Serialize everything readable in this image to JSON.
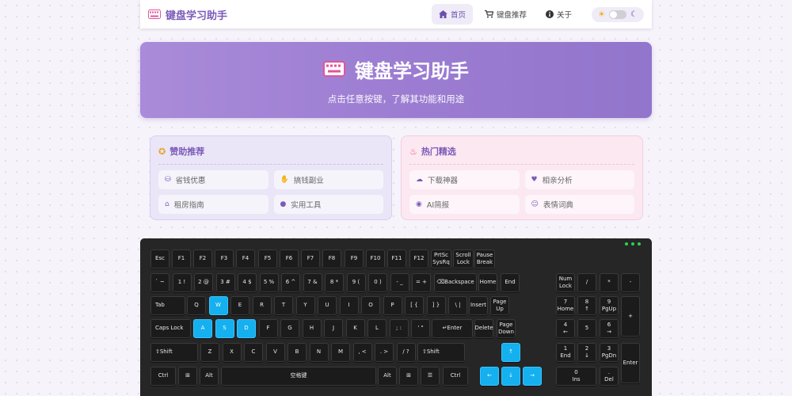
{
  "navbar": {
    "brand": "键盘学习助手",
    "links": [
      {
        "label": "首页",
        "icon": "home-icon",
        "active": true
      },
      {
        "label": "键盘推荐",
        "icon": "cart-icon",
        "active": false
      },
      {
        "label": "关于",
        "icon": "info-icon",
        "active": false
      }
    ],
    "theme_toggle": {
      "light_icon": "sun-icon",
      "dark_icon": "moon-icon",
      "state": "light"
    }
  },
  "hero": {
    "title": "键盘学习助手",
    "subtitle": "点击任意按键，了解其功能和用途"
  },
  "sponsor": {
    "title": "赞助推荐",
    "items": [
      {
        "label": "省钱优惠",
        "icon": "coins-icon"
      },
      {
        "label": "搞钱副业",
        "icon": "hand-coin-icon"
      },
      {
        "label": "租房指南",
        "icon": "house-icon"
      },
      {
        "label": "实用工具",
        "icon": "bulb-icon"
      }
    ]
  },
  "hot": {
    "title": "热门精选",
    "items": [
      {
        "label": "下载神器",
        "icon": "cloud-download-icon"
      },
      {
        "label": "相亲分析",
        "icon": "heart-icon"
      },
      {
        "label": "AI简报",
        "icon": "robot-icon"
      },
      {
        "label": "表情词典",
        "icon": "smile-icon"
      }
    ]
  },
  "colors": {
    "accent": "#7b5bb8",
    "key_highlight": "#14b0f0",
    "keyboard_bg": "#262626",
    "led": "#2ad34f"
  },
  "keyboard": {
    "highlighted_keys": [
      "W",
      "A",
      "S",
      "D",
      "↑",
      "←",
      "↓",
      "→"
    ],
    "keys": {
      "esc": "Esc",
      "f1": "F1",
      "f2": "F2",
      "f3": "F3",
      "f4": "F4",
      "f5": "F5",
      "f6": "F6",
      "f7": "F7",
      "f8": "F8",
      "f9": "F9",
      "f10": "F10",
      "f11": "F11",
      "f12": "F12",
      "prtsc": "PrtSc\nSysRq",
      "scroll": "Scroll\nLock",
      "pause": "Pause\nBreak",
      "backtick": "` ~",
      "n1": "1 !",
      "n2": "2 @",
      "n3": "3 #",
      "n4": "4 $",
      "n5": "5 %",
      "n6": "6 ^",
      "n7": "7 &",
      "n8": "8 *",
      "n9": "9 (",
      "n0": "0 )",
      "minus": "- _",
      "equal": "= +",
      "backspace": "⌫Backspace",
      "home": "Home",
      "end": "End",
      "tab": "Tab",
      "q": "Q",
      "w": "W",
      "e": "E",
      "r": "R",
      "t": "T",
      "y": "Y",
      "u": "U",
      "i": "I",
      "o": "O",
      "p": "P",
      "lbracket": "[ {",
      "rbracket": "] }",
      "backslash": "\\ |",
      "insert": "Insert",
      "pgup": "Page\nUp",
      "caps": "Caps Lock",
      "a": "A",
      "s": "S",
      "d": "D",
      "f": "F",
      "g": "G",
      "h": "H",
      "j": "J",
      "k": "K",
      "l": "L",
      "semicolon": "; :",
      "quote": "' \"",
      "enter": "↵Enter",
      "delete": "Delete",
      "pgdn": "Page\nDown",
      "lshift": "⇧Shift",
      "z": "Z",
      "x": "X",
      "c": "C",
      "v": "V",
      "b": "B",
      "n": "N",
      "m": "M",
      "comma": ", <",
      "period": ". >",
      "slash": "/ ?",
      "rshift": "⇧Shift",
      "lctrl": "Ctrl",
      "lwin": "⊞",
      "lalt": "Alt",
      "space": "空格键",
      "ralt": "Alt",
      "rwin": "⊞",
      "menu": "☰",
      "rctrl": "Ctrl",
      "up": "↑",
      "left": "←",
      "down": "↓",
      "right": "→",
      "numlock": "Num\nLock",
      "numdiv": "/",
      "nummul": "*",
      "numsub": "-",
      "num7": "7\nHome",
      "num8": "8\n↑",
      "num9": "9\nPgUp",
      "numadd": "+",
      "num4": "4\n←",
      "num5": "5",
      "num6": "6\n→",
      "num1": "1\nEnd",
      "num2": "2\n↓",
      "num3": "3\nPgDn",
      "numenter": "Enter",
      "num0": "0\nIns",
      "numdot": ".\nDel"
    }
  }
}
